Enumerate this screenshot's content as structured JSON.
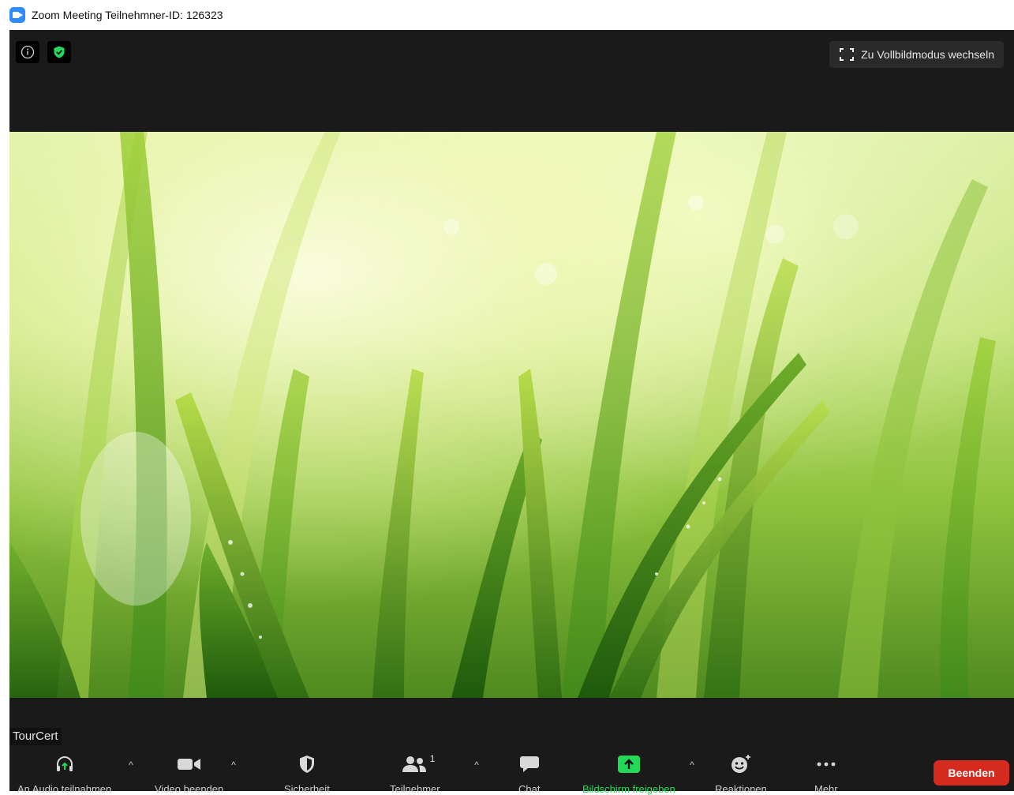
{
  "window": {
    "title": "Zoom Meeting Teilnehmner-ID: 126323"
  },
  "top_bar": {
    "fullscreen_label": "Zu Vollbildmodus wechseln"
  },
  "participant": {
    "name": "TourCert"
  },
  "toolbar": {
    "audio_label": "An Audio teilnahmen",
    "video_label": "Video beenden",
    "security_label": "Sicherheit",
    "participants_label": "Teilnehmer",
    "participants_count": "1",
    "chat_label": "Chat",
    "share_label": "Bildschirm freigeben",
    "reactions_label": "Reaktionen",
    "more_label": "Mehr",
    "end_label": "Beenden"
  },
  "colors": {
    "accent": "#2d8cff",
    "share_green": "#23d959",
    "end_red": "#d52b1e",
    "shield_green": "#23d959"
  }
}
